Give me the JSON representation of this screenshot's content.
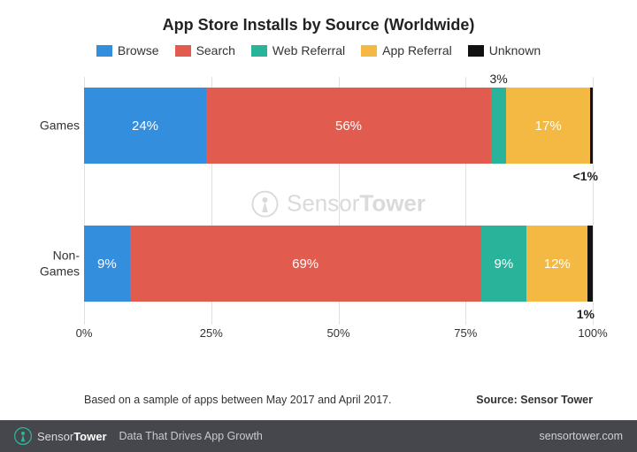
{
  "chart_data": {
    "type": "bar",
    "orientation": "horizontal-stacked",
    "title": "App Store Installs by Source (Worldwide)",
    "categories": [
      "Games",
      "Non-\nGames"
    ],
    "series": [
      {
        "name": "Browse",
        "color": "#338EDE",
        "values": [
          24,
          9
        ]
      },
      {
        "name": "Search",
        "color": "#E15B4E",
        "values": [
          56,
          69
        ]
      },
      {
        "name": "Web Referral",
        "color": "#29B39B",
        "values": [
          3,
          9
        ]
      },
      {
        "name": "App Referral",
        "color": "#F4B942",
        "values": [
          17,
          12
        ]
      },
      {
        "name": "Unknown",
        "color": "#111111",
        "values": [
          0.5,
          1
        ]
      }
    ],
    "value_labels": [
      [
        "24%",
        "56%",
        "3%",
        "17%",
        "<1%"
      ],
      [
        "9%",
        "69%",
        "9%",
        "12%",
        "1%"
      ]
    ],
    "xlabel": "",
    "ylabel": "",
    "xlim": [
      0,
      100
    ],
    "x_ticks": [
      "0%",
      "25%",
      "50%",
      "75%",
      "100%"
    ],
    "footnote": "Based on a sample of apps between May 2017 and April 2017.",
    "source": "Source: Sensor Tower"
  },
  "watermark": "SensorTower",
  "footer": {
    "brand": "SensorTower",
    "tagline": "Data That Drives App Growth",
    "url": "sensortower.com"
  }
}
